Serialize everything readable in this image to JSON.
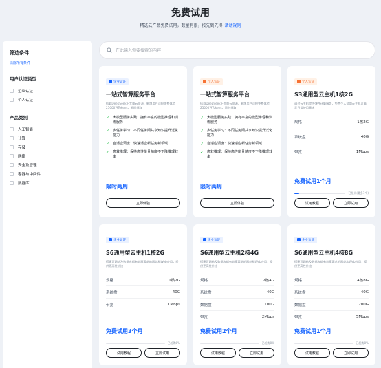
{
  "header": {
    "title": "免费试用",
    "subtitle": "精选云产品免费试用，数量有限，按先到先得",
    "rules_link": "活动规则"
  },
  "sidebar": {
    "title": "筛选条件",
    "clear_label": "清除所有条件",
    "cert_group": {
      "title": "用户认证类型",
      "options": [
        "企业认证",
        "个人认证"
      ]
    },
    "category_group": {
      "title": "产品类别",
      "options": [
        "人工智能",
        "计算",
        "存储",
        "网络",
        "安全及管理",
        "容器与中间件",
        "数据库"
      ]
    }
  },
  "search": {
    "placeholder": "在此输入你要搜索的内容",
    "value": ""
  },
  "colors": {
    "accent": "#1664ff",
    "enterprise_badge_bg": "#eaf1ff",
    "personal_badge": "#f77234",
    "personal_badge_bg": "#fff1e6",
    "check": "#00b42a"
  },
  "cards": [
    {
      "badge": "企业认证",
      "title": "一站式智算服务平台",
      "desc": "搭载DeepSeek上大量云资源，新增用户可抢免费体验25000万Tokens，限时领取",
      "features": [
        "大模型服务实践：拥有丰富的模型推理和训练服务",
        "多任务学习：不同任务间共享知识提升泛化能力",
        "自适应调度：快速适应新任务新领域",
        "高效推理：保持高性能且精度不下降推理效率"
      ],
      "trial": "限时两周",
      "buttons": [
        "立即体验"
      ]
    },
    {
      "badge": "个人认证",
      "title": "一站式智算服务平台",
      "desc": "搭载DeepSeek上大量云资源，新增用户可抢免费体验25000万Tokens，限时领取",
      "features": [
        "大模型服务实践：拥有丰富的模型推理和训练服务",
        "多任务学习：不同任务间共享知识提升泛化能力",
        "自适应调度：快速适应新任务新领域",
        "高效推理：保持高性能且精度不下降推理效率"
      ],
      "trial": "限时两周",
      "buttons": [
        "立即体验"
      ]
    },
    {
      "badge": "个人认证",
      "title": "S3通用型云主机1核2G",
      "desc": "通过云主机提供弹性计算服务，免费个人试用云主机可满足日常使用需求",
      "specs": [
        {
          "label": "规格",
          "value": "1核2G"
        },
        {
          "label": "系统盘",
          "value": "40G"
        },
        {
          "label": "带宽",
          "value": "1Mbps"
        }
      ],
      "progress": 0.09,
      "progress_text": "已抢光(最多1个)",
      "trial": "免费试用1个月",
      "buttons": [
        "试用教程",
        "立即试用"
      ]
    },
    {
      "badge": "企业认证",
      "title": "S6通用型云主机1核2G",
      "desc": "搭建可网络及数据库都有较高要求的网站和Web应用，提供更高性价比",
      "specs": [
        {
          "label": "规格",
          "value": "1核2G"
        },
        {
          "label": "系统盘",
          "value": "40G"
        },
        {
          "label": "带宽",
          "value": "1Mbps"
        }
      ],
      "progress": 0,
      "progress_text": "已抢购0%",
      "trial": "免费试用3个月",
      "buttons": [
        "试用教程",
        "立即试用"
      ]
    },
    {
      "badge": "企业认证",
      "title": "S6通用型云主机2核4G",
      "desc": "搭建可网络及数据库都有较高要求的网站和Web应用，提供更高性价比",
      "specs": [
        {
          "label": "规格",
          "value": "2核4G"
        },
        {
          "label": "系统盘",
          "value": "40G"
        },
        {
          "label": "数据盘",
          "value": "100G"
        },
        {
          "label": "带宽",
          "value": "2Mbps"
        }
      ],
      "progress": 0,
      "progress_text": "已抢购0%",
      "trial": "免费试用2个月",
      "buttons": [
        "试用教程",
        "立即试用"
      ]
    },
    {
      "badge": "企业认证",
      "title": "S6通用型云主机4核8G",
      "desc": "搭建可网络及数据库都有较高要求的网站和Web应用，提供更高性价比",
      "specs": [
        {
          "label": "规格",
          "value": "4核8G"
        },
        {
          "label": "系统盘",
          "value": "40G"
        },
        {
          "label": "数据盘",
          "value": "200G"
        },
        {
          "label": "带宽",
          "value": "5Mbps"
        }
      ],
      "progress": 0,
      "progress_text": "已抢购0%",
      "trial": "免费试用1个月",
      "buttons": [
        "试用教程",
        "立即试用"
      ]
    }
  ]
}
